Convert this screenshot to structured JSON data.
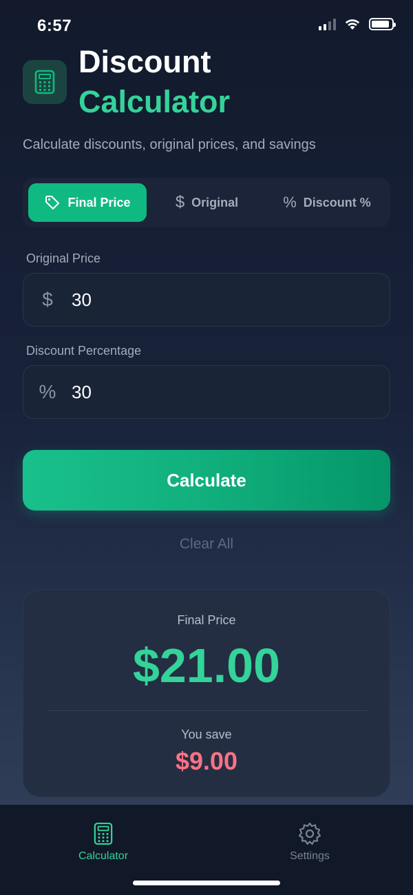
{
  "status": {
    "time": "6:57",
    "battery_level": 0.9
  },
  "header": {
    "title_line1": "Discount",
    "title_line2": "Calculator",
    "subtitle": "Calculate discounts, original prices, and savings",
    "app_icon": "calculator-icon"
  },
  "tabs": [
    {
      "label": "Final Price",
      "icon": "tag-icon",
      "active": true
    },
    {
      "label": "Original",
      "icon": "dollar-icon",
      "active": false
    },
    {
      "label": "Discount %",
      "icon": "percent-icon",
      "active": false
    }
  ],
  "fields": {
    "original_price": {
      "label": "Original Price",
      "icon": "$",
      "value": "30"
    },
    "discount": {
      "label": "Discount Percentage",
      "icon": "%",
      "value": "30"
    }
  },
  "actions": {
    "calculate": "Calculate",
    "clear": "Clear All"
  },
  "result": {
    "label": "Final Price",
    "value": "$21.00",
    "save_label": "You save",
    "save_value": "$9.00"
  },
  "nav": [
    {
      "label": "Calculator",
      "icon": "calculator-icon",
      "active": true
    },
    {
      "label": "Settings",
      "icon": "gear-icon",
      "active": false
    }
  ],
  "colors": {
    "accent": "#10b981",
    "accent_text": "#34d399",
    "savings": "#fb7185",
    "background": "#121a2c"
  }
}
